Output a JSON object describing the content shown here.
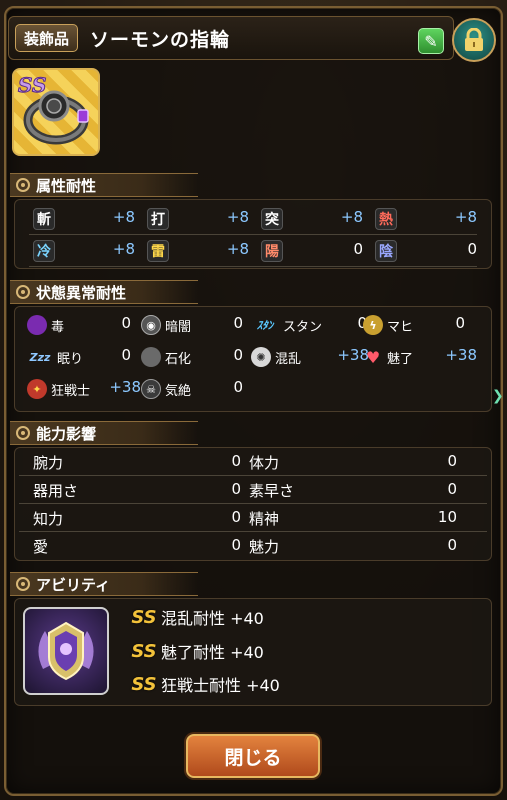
{
  "header": {
    "category": "装飾品",
    "item_name": "ソーモンの指輪"
  },
  "sections": {
    "element": "属性耐性",
    "status": "状態異常耐性",
    "ability_effect": "能力影響",
    "ability": "アビリティ"
  },
  "element_resist": [
    {
      "icon": "斬",
      "value": "+8"
    },
    {
      "icon": "打",
      "value": "+8"
    },
    {
      "icon": "突",
      "value": "+8"
    },
    {
      "icon": "熱",
      "value": "+8"
    },
    {
      "icon": "冷",
      "value": "+8"
    },
    {
      "icon": "雷",
      "value": "+8"
    },
    {
      "icon": "陽",
      "value": "0"
    },
    {
      "icon": "陰",
      "value": "0"
    }
  ],
  "status_resist": [
    {
      "label": "毒",
      "value": "0"
    },
    {
      "label": "暗闇",
      "value": "0"
    },
    {
      "label": "スタン",
      "value": "0",
      "icon_text": "ｽﾀﾝ"
    },
    {
      "label": "マヒ",
      "value": "0"
    },
    {
      "label": "眠り",
      "value": "0",
      "icon_text": "Zzz"
    },
    {
      "label": "石化",
      "value": "0"
    },
    {
      "label": "混乱",
      "value": "+38"
    },
    {
      "label": "魅了",
      "value": "+38"
    },
    {
      "label": "狂戦士",
      "value": "+38"
    },
    {
      "label": "気絶",
      "value": "0"
    }
  ],
  "ability_effects": [
    {
      "label": "腕力",
      "value": "0"
    },
    {
      "label": "体力",
      "value": "0"
    },
    {
      "label": "器用さ",
      "value": "0"
    },
    {
      "label": "素早さ",
      "value": "0"
    },
    {
      "label": "知力",
      "value": "0"
    },
    {
      "label": "精神",
      "value": "10"
    },
    {
      "label": "愛",
      "value": "0"
    },
    {
      "label": "魅力",
      "value": "0"
    }
  ],
  "abilities": [
    {
      "text": "混乱耐性 +40"
    },
    {
      "text": "魅了耐性 +40"
    },
    {
      "text": "狂戦士耐性 +40"
    }
  ],
  "close_button": "閉じる",
  "colors": {
    "positive_value": "#8cc8ff",
    "close_button": "#d06a2e",
    "frame_gold": "#c8a05a"
  }
}
